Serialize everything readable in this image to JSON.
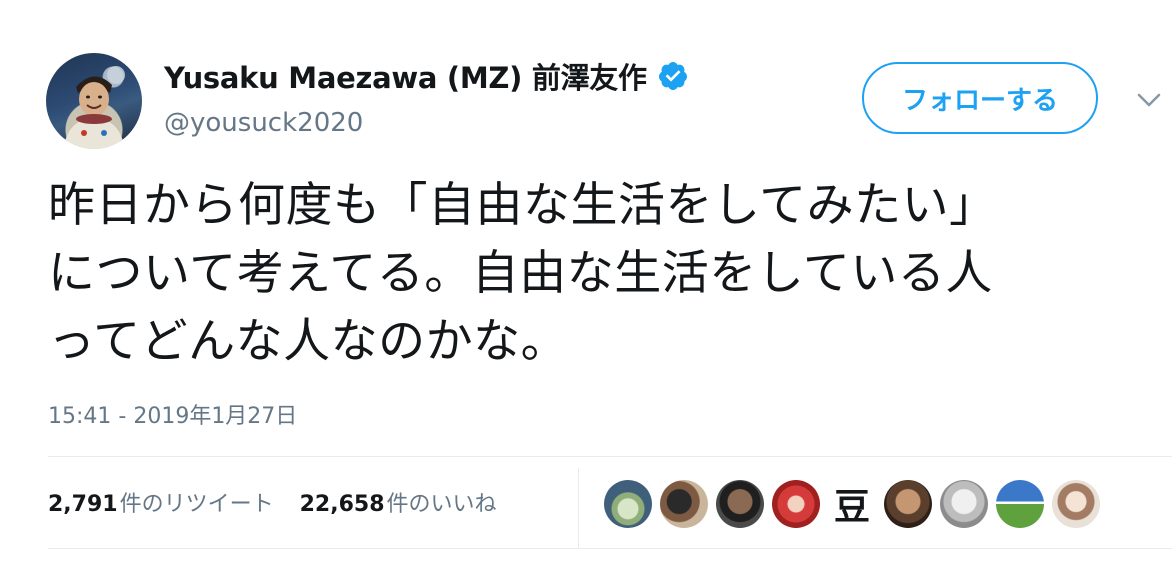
{
  "user": {
    "display_name": "Yusaku Maezawa (MZ) 前澤友作",
    "handle": "@yousuck2020",
    "verified": true,
    "avatar_icon": "profile-avatar"
  },
  "follow_button": {
    "label": "フォローする"
  },
  "menu": {
    "icon": "chevron-down-icon"
  },
  "tweet": {
    "lines": [
      "昨日から何度も「自由な生活をしてみたい」",
      "について考えてる。自由な生活をしている人",
      "ってどんな人なのかな。"
    ],
    "timestamp": "15:41 - 2019年1月27日"
  },
  "stats": {
    "retweets": {
      "count": "2,791",
      "label": "件のリツイート"
    },
    "likes": {
      "count": "22,658",
      "label": "件のいいね"
    }
  },
  "likers": [
    {
      "name": "liker-1-avatar"
    },
    {
      "name": "liker-2-avatar"
    },
    {
      "name": "liker-3-avatar"
    },
    {
      "name": "liker-4-avatar"
    },
    {
      "name": "liker-5-avatar",
      "glyph": "豆"
    },
    {
      "name": "liker-6-avatar"
    },
    {
      "name": "liker-7-avatar"
    },
    {
      "name": "liker-8-avatar"
    },
    {
      "name": "liker-9-avatar"
    }
  ],
  "colors": {
    "accent": "#1da1f2",
    "text": "#14171a",
    "secondary_text": "#657786",
    "divider": "#e6ecf0"
  }
}
